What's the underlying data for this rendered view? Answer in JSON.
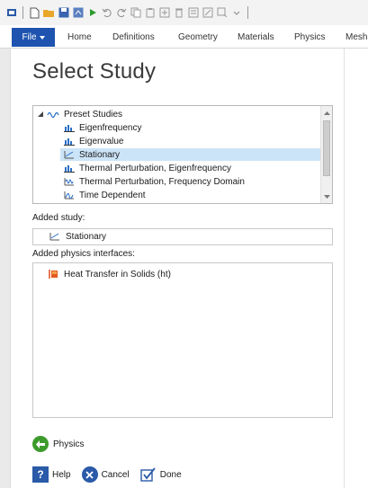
{
  "ribbon": {
    "file_label": "File",
    "tabs": [
      "Home",
      "Definitions",
      "Geometry",
      "Materials",
      "Physics",
      "Mesh"
    ]
  },
  "page": {
    "title": "Select Study"
  },
  "tree": {
    "root_label": "Preset Studies",
    "items": [
      {
        "label": "Eigenfrequency",
        "icon": "eigen-chart-icon"
      },
      {
        "label": "Eigenvalue",
        "icon": "eigen-chart-icon"
      },
      {
        "label": "Stationary",
        "icon": "stationary-icon",
        "selected": true
      },
      {
        "label": "Thermal Perturbation, Eigenfrequency",
        "icon": "eigen-chart-icon"
      },
      {
        "label": "Thermal Perturbation, Frequency Domain",
        "icon": "frequency-domain-icon"
      },
      {
        "label": "Time Dependent",
        "icon": "time-dependent-icon"
      }
    ]
  },
  "added_study": {
    "label": "Added study:",
    "value": "Stationary"
  },
  "added_physics": {
    "label": "Added physics interfaces:",
    "items": [
      "Heat Transfer in Solids (ht)"
    ]
  },
  "nav": {
    "back_label": "Physics"
  },
  "buttons": {
    "help": "Help",
    "cancel": "Cancel",
    "done": "Done"
  },
  "colors": {
    "accent": "#1e54b0",
    "selection": "#cce4f7",
    "back_green": "#3d9b2b"
  }
}
